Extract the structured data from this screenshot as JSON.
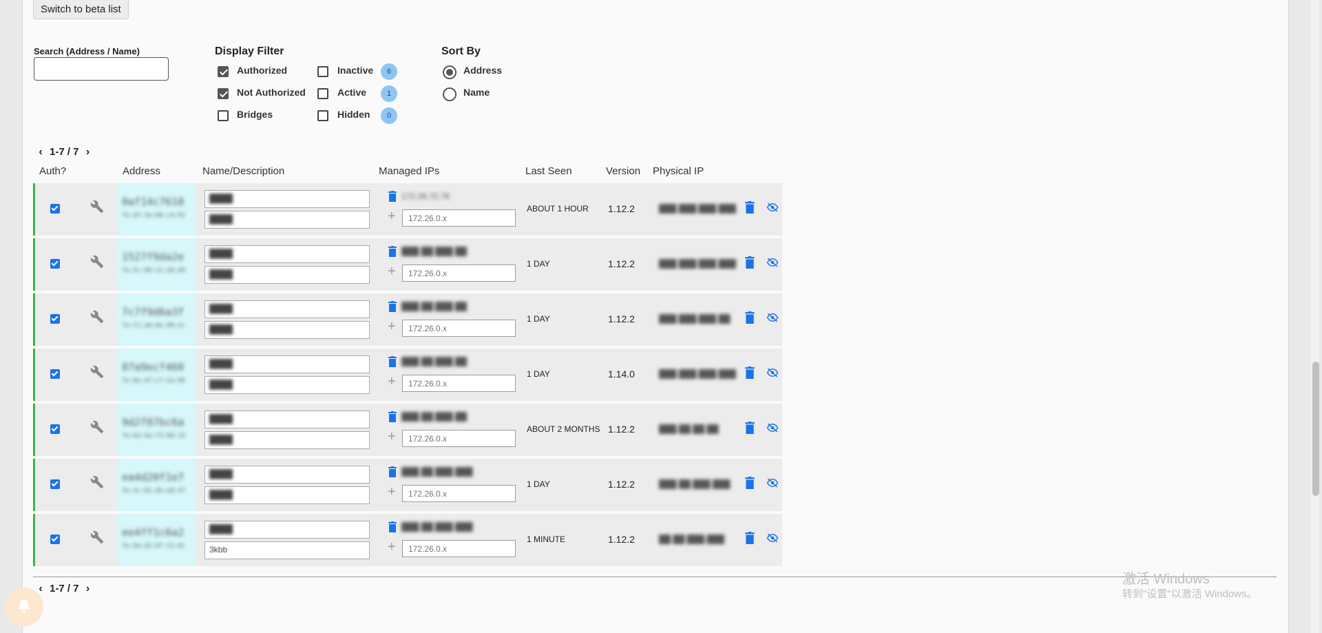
{
  "top_button": {
    "label": "Switch to beta list"
  },
  "search": {
    "label": "Search (Address / Name)",
    "value": ""
  },
  "display_filter": {
    "title": "Display Filter",
    "options": [
      {
        "label": "Authorized",
        "checked": true
      },
      {
        "label": "Not Authorized",
        "checked": true
      },
      {
        "label": "Bridges",
        "checked": false
      },
      {
        "label": "Inactive",
        "checked": false,
        "count": "6"
      },
      {
        "label": "Active",
        "checked": false,
        "count": "1"
      },
      {
        "label": "Hidden",
        "checked": false,
        "count": "0"
      }
    ]
  },
  "sort_by": {
    "title": "Sort By",
    "options": [
      {
        "label": "Address",
        "selected": true
      },
      {
        "label": "Name",
        "selected": false
      }
    ]
  },
  "pager": {
    "range": "1-7 / 7"
  },
  "columns": {
    "auth": "Auth?",
    "address": "Address",
    "name": "Name/Description",
    "managed_ips": "Managed IPs",
    "last_seen": "Last Seen",
    "version": "Version",
    "physical_ip": "Physical IP"
  },
  "members": [
    {
      "address": "0af14c7618",
      "address_sub": "7e:d7:3a:b6:c4:91",
      "name": "████",
      "description": "████",
      "managed_ip": "172.26.72.76",
      "ip_placeholder": "172.26.0.x",
      "last_seen": "ABOUT 1 HOUR",
      "version": "1.12.2",
      "physical_ip": "███.███.███.███"
    },
    {
      "address": "1527f9da2e",
      "address_sub": "7e:5c:90:11:e0:60",
      "name": "████",
      "description": "████",
      "managed_ip": "███.██.███.██",
      "ip_placeholder": "172.26.0.x",
      "last_seen": "1 DAY",
      "version": "1.12.2",
      "physical_ip": "███.███.███.███"
    },
    {
      "address": "7c7f9d6a3f",
      "address_sub": "7e:f1:a8:6e:90:2c",
      "name": "████",
      "description": "████",
      "managed_ip": "███.██.███.██",
      "ip_placeholder": "172.26.0.x",
      "last_seen": "1 DAY",
      "version": "1.12.2",
      "physical_ip": "███.███.███.██"
    },
    {
      "address": "87a9ecf460",
      "address_sub": "7e:6e:4f:c7:2a:9b",
      "name": "████",
      "description": "████",
      "managed_ip": "███.██.███.██",
      "ip_placeholder": "172.26.0.x",
      "last_seen": "1 DAY",
      "version": "1.14.0",
      "physical_ip": "███.███.███.███"
    },
    {
      "address": "9d2f87bc6a",
      "address_sub": "7e:b2:4a:f3:8d:15",
      "name": "████",
      "description": "████",
      "managed_ip": "███.██.███.██",
      "ip_placeholder": "172.26.0.x",
      "last_seen": "ABOUT 2 MONTHS",
      "version": "1.12.2",
      "physical_ip": "███.██.██.██"
    },
    {
      "address": "ea4d20f1e7",
      "address_sub": "7e:3c:81:d5:a0:47",
      "name": "████",
      "description": "████",
      "managed_ip": "███.██.███.███",
      "ip_placeholder": "172.26.0.x",
      "last_seen": "1 DAY",
      "version": "1.12.2",
      "physical_ip": "███.██.███.███"
    },
    {
      "address": "ee4ff1c6a2",
      "address_sub": "7e:9a:d2:6f:31:8c",
      "name": "████",
      "description": "3kbb",
      "managed_ip": "███.██.███.███",
      "ip_placeholder": "172.26.0.x",
      "last_seen": "1 MINUTE",
      "version": "1.12.2",
      "physical_ip": "██.██.███.███"
    }
  ],
  "watermark": {
    "line1": "激活 Windows",
    "line2": "转到\"设置\"以激活 Windows。"
  },
  "colors": {
    "accent": "#1a73e8",
    "row_border": "#39b54a",
    "address_bg": "#d6f8fb",
    "badge": "#8ec5f3"
  },
  "icons": [
    "wrench-icon",
    "trash-icon",
    "eye-off-icon",
    "plus-icon",
    "chevron-left-icon",
    "chevron-right-icon",
    "bell-icon"
  ]
}
